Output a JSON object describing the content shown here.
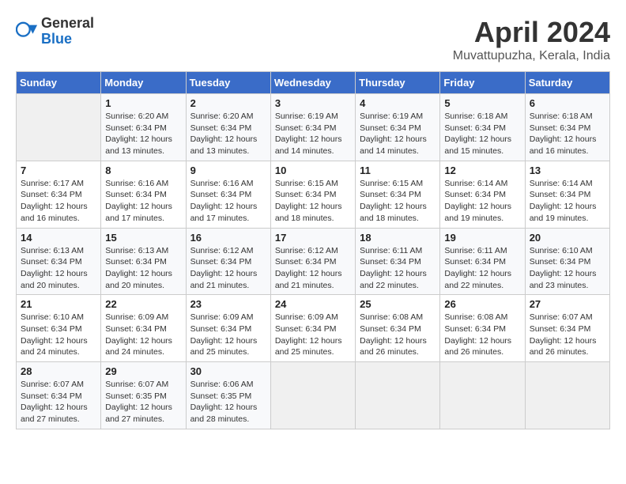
{
  "header": {
    "logo_general": "General",
    "logo_blue": "Blue",
    "title": "April 2024",
    "location": "Muvattupuzha, Kerala, India"
  },
  "calendar": {
    "days_of_week": [
      "Sunday",
      "Monday",
      "Tuesday",
      "Wednesday",
      "Thursday",
      "Friday",
      "Saturday"
    ],
    "weeks": [
      [
        {
          "day": "",
          "info": ""
        },
        {
          "day": "1",
          "info": "Sunrise: 6:20 AM\nSunset: 6:34 PM\nDaylight: 12 hours\nand 13 minutes."
        },
        {
          "day": "2",
          "info": "Sunrise: 6:20 AM\nSunset: 6:34 PM\nDaylight: 12 hours\nand 13 minutes."
        },
        {
          "day": "3",
          "info": "Sunrise: 6:19 AM\nSunset: 6:34 PM\nDaylight: 12 hours\nand 14 minutes."
        },
        {
          "day": "4",
          "info": "Sunrise: 6:19 AM\nSunset: 6:34 PM\nDaylight: 12 hours\nand 14 minutes."
        },
        {
          "day": "5",
          "info": "Sunrise: 6:18 AM\nSunset: 6:34 PM\nDaylight: 12 hours\nand 15 minutes."
        },
        {
          "day": "6",
          "info": "Sunrise: 6:18 AM\nSunset: 6:34 PM\nDaylight: 12 hours\nand 16 minutes."
        }
      ],
      [
        {
          "day": "7",
          "info": "Sunrise: 6:17 AM\nSunset: 6:34 PM\nDaylight: 12 hours\nand 16 minutes."
        },
        {
          "day": "8",
          "info": "Sunrise: 6:16 AM\nSunset: 6:34 PM\nDaylight: 12 hours\nand 17 minutes."
        },
        {
          "day": "9",
          "info": "Sunrise: 6:16 AM\nSunset: 6:34 PM\nDaylight: 12 hours\nand 17 minutes."
        },
        {
          "day": "10",
          "info": "Sunrise: 6:15 AM\nSunset: 6:34 PM\nDaylight: 12 hours\nand 18 minutes."
        },
        {
          "day": "11",
          "info": "Sunrise: 6:15 AM\nSunset: 6:34 PM\nDaylight: 12 hours\nand 18 minutes."
        },
        {
          "day": "12",
          "info": "Sunrise: 6:14 AM\nSunset: 6:34 PM\nDaylight: 12 hours\nand 19 minutes."
        },
        {
          "day": "13",
          "info": "Sunrise: 6:14 AM\nSunset: 6:34 PM\nDaylight: 12 hours\nand 19 minutes."
        }
      ],
      [
        {
          "day": "14",
          "info": "Sunrise: 6:13 AM\nSunset: 6:34 PM\nDaylight: 12 hours\nand 20 minutes."
        },
        {
          "day": "15",
          "info": "Sunrise: 6:13 AM\nSunset: 6:34 PM\nDaylight: 12 hours\nand 20 minutes."
        },
        {
          "day": "16",
          "info": "Sunrise: 6:12 AM\nSunset: 6:34 PM\nDaylight: 12 hours\nand 21 minutes."
        },
        {
          "day": "17",
          "info": "Sunrise: 6:12 AM\nSunset: 6:34 PM\nDaylight: 12 hours\nand 21 minutes."
        },
        {
          "day": "18",
          "info": "Sunrise: 6:11 AM\nSunset: 6:34 PM\nDaylight: 12 hours\nand 22 minutes."
        },
        {
          "day": "19",
          "info": "Sunrise: 6:11 AM\nSunset: 6:34 PM\nDaylight: 12 hours\nand 22 minutes."
        },
        {
          "day": "20",
          "info": "Sunrise: 6:10 AM\nSunset: 6:34 PM\nDaylight: 12 hours\nand 23 minutes."
        }
      ],
      [
        {
          "day": "21",
          "info": "Sunrise: 6:10 AM\nSunset: 6:34 PM\nDaylight: 12 hours\nand 24 minutes."
        },
        {
          "day": "22",
          "info": "Sunrise: 6:09 AM\nSunset: 6:34 PM\nDaylight: 12 hours\nand 24 minutes."
        },
        {
          "day": "23",
          "info": "Sunrise: 6:09 AM\nSunset: 6:34 PM\nDaylight: 12 hours\nand 25 minutes."
        },
        {
          "day": "24",
          "info": "Sunrise: 6:09 AM\nSunset: 6:34 PM\nDaylight: 12 hours\nand 25 minutes."
        },
        {
          "day": "25",
          "info": "Sunrise: 6:08 AM\nSunset: 6:34 PM\nDaylight: 12 hours\nand 26 minutes."
        },
        {
          "day": "26",
          "info": "Sunrise: 6:08 AM\nSunset: 6:34 PM\nDaylight: 12 hours\nand 26 minutes."
        },
        {
          "day": "27",
          "info": "Sunrise: 6:07 AM\nSunset: 6:34 PM\nDaylight: 12 hours\nand 26 minutes."
        }
      ],
      [
        {
          "day": "28",
          "info": "Sunrise: 6:07 AM\nSunset: 6:34 PM\nDaylight: 12 hours\nand 27 minutes."
        },
        {
          "day": "29",
          "info": "Sunrise: 6:07 AM\nSunset: 6:35 PM\nDaylight: 12 hours\nand 27 minutes."
        },
        {
          "day": "30",
          "info": "Sunrise: 6:06 AM\nSunset: 6:35 PM\nDaylight: 12 hours\nand 28 minutes."
        },
        {
          "day": "",
          "info": ""
        },
        {
          "day": "",
          "info": ""
        },
        {
          "day": "",
          "info": ""
        },
        {
          "day": "",
          "info": ""
        }
      ]
    ]
  }
}
